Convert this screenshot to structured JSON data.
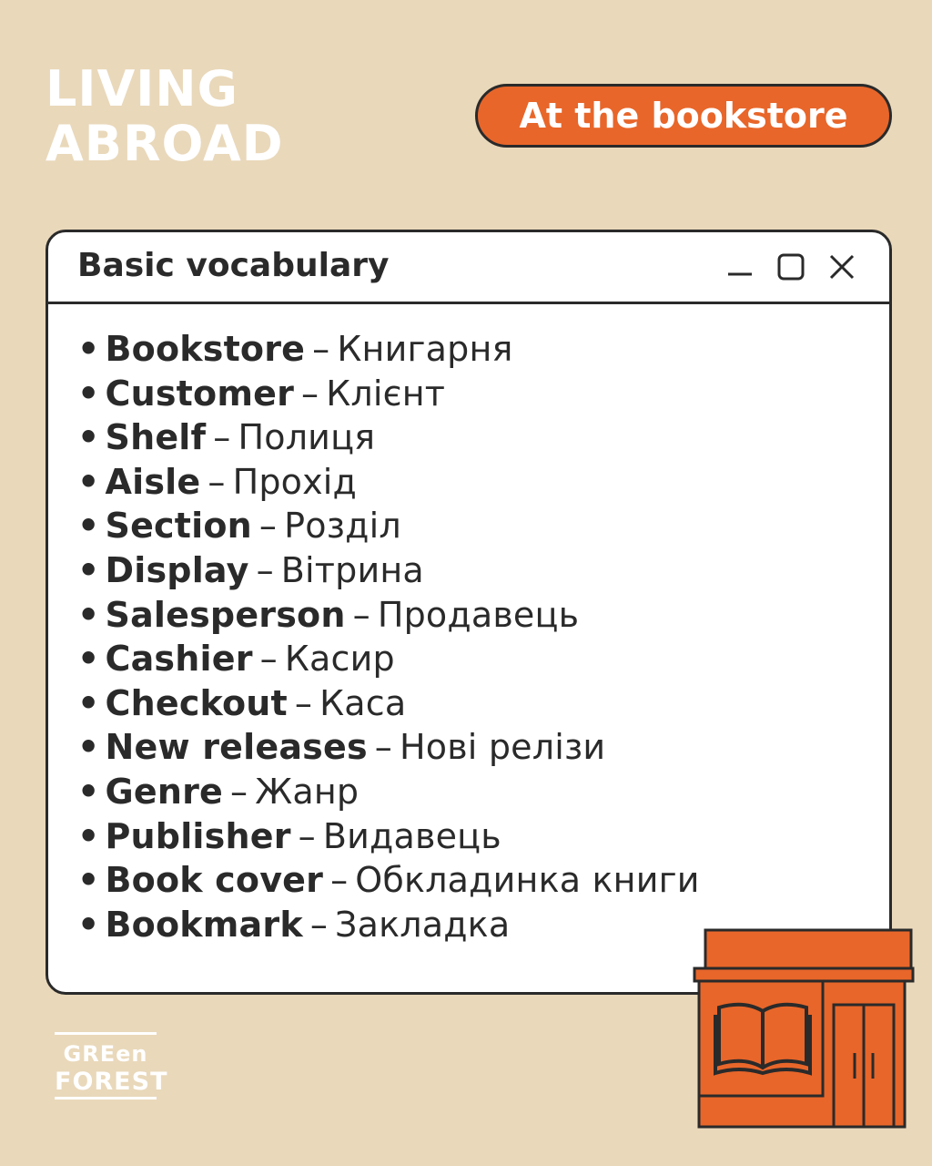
{
  "header": {
    "title_line1": "LIVING",
    "title_line2": "ABROAD",
    "badge": "At the bookstore"
  },
  "window": {
    "title": "Basic vocabulary",
    "controls": [
      "minimize-icon",
      "maximize-icon",
      "close-icon"
    ]
  },
  "vocab": [
    {
      "term": "Bookstore",
      "translation": "Книгарня"
    },
    {
      "term": "Customer",
      "translation": "Клієнт"
    },
    {
      "term": "Shelf",
      "translation": "Полиця"
    },
    {
      "term": "Aisle",
      "translation": "Прохід"
    },
    {
      "term": "Section",
      "translation": "Розділ"
    },
    {
      "term": "Display",
      "translation": "Вітрина"
    },
    {
      "term": "Salesperson",
      "translation": "Продавець"
    },
    {
      "term": "Cashier",
      "translation": "Касир"
    },
    {
      "term": "Checkout",
      "translation": "Каса"
    },
    {
      "term": "New releases",
      "translation": "Нові релізи"
    },
    {
      "term": "Genre",
      "translation": "Жанр"
    },
    {
      "term": "Publisher",
      "translation": "Видавець"
    },
    {
      "term": "Book cover",
      "translation": "Обкладинка книги"
    },
    {
      "term": "Bookmark",
      "translation": "Закладка"
    }
  ],
  "logo": {
    "line1": "GREen",
    "line2": "FOREST"
  },
  "colors": {
    "background": "#e9d8ba",
    "accent": "#e8662a",
    "outline": "#2a2a2a"
  },
  "illustration": "bookstore-icon"
}
